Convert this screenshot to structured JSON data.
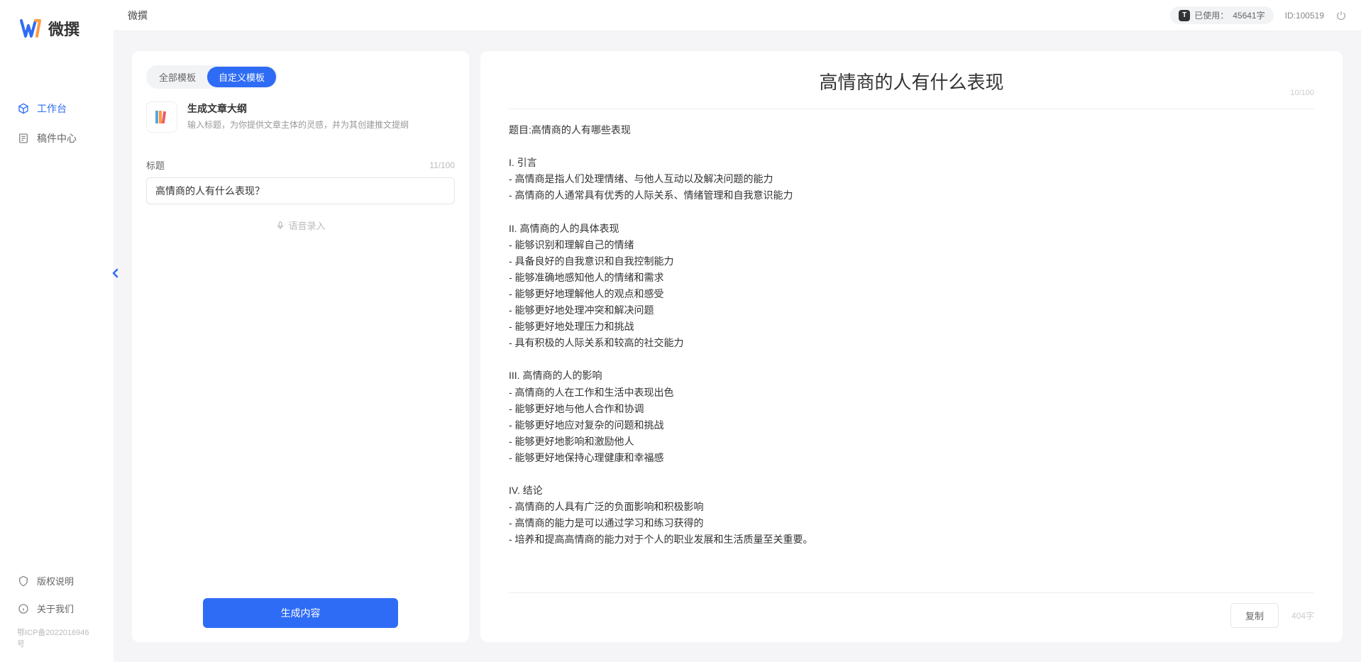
{
  "app": {
    "name": "微撰",
    "icp": "鄂ICP备2022016946号"
  },
  "sidebar": {
    "nav": [
      {
        "label": "工作台",
        "icon": "workbench"
      },
      {
        "label": "稿件中心",
        "icon": "docs"
      }
    ],
    "footer_nav": [
      {
        "label": "版权说明",
        "icon": "shield"
      },
      {
        "label": "关于我们",
        "icon": "info"
      }
    ]
  },
  "header": {
    "title": "微撰",
    "usage_prefix": "已使用：",
    "usage_value": "45641字",
    "id_label": "ID:100519"
  },
  "left": {
    "tabs": [
      {
        "label": "全部模板"
      },
      {
        "label": "自定义模板"
      }
    ],
    "template": {
      "title": "生成文章大纲",
      "desc": "输入标题，为你提供文章主体的灵感，并为其创建推文提纲"
    },
    "form": {
      "label": "标题",
      "count": "11/100",
      "value": "高情商的人有什么表现？",
      "voice_label": "语音录入"
    },
    "generate_label": "生成内容"
  },
  "right": {
    "title": "高情商的人有什么表现",
    "title_count": "10/100",
    "body": "题目:高情商的人有哪些表现\n\nI. 引言\n- 高情商是指人们处理情绪、与他人互动以及解决问题的能力\n- 高情商的人通常具有优秀的人际关系、情绪管理和自我意识能力\n\nII. 高情商的人的具体表现\n- 能够识别和理解自己的情绪\n- 具备良好的自我意识和自我控制能力\n- 能够准确地感知他人的情绪和需求\n- 能够更好地理解他人的观点和感受\n- 能够更好地处理冲突和解决问题\n- 能够更好地处理压力和挑战\n- 具有积极的人际关系和较高的社交能力\n\nIII. 高情商的人的影响\n- 高情商的人在工作和生活中表现出色\n- 能够更好地与他人合作和协调\n- 能够更好地应对复杂的问题和挑战\n- 能够更好地影响和激励他人\n- 能够更好地保持心理健康和幸福感\n\nIV. 结论\n- 高情商的人具有广泛的负面影响和积极影响\n- 高情商的能力是可以通过学习和练习获得的\n- 培养和提高高情商的能力对于个人的职业发展和生活质量至关重要。",
    "copy_label": "复制",
    "word_count": "404字"
  }
}
